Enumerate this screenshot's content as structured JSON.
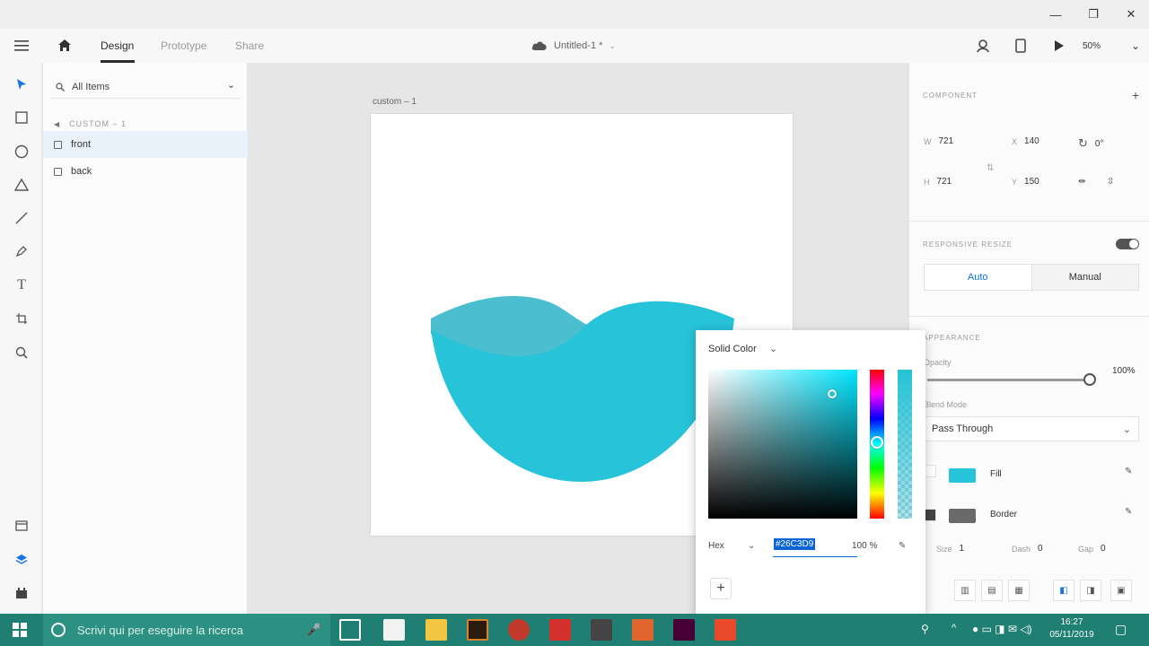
{
  "window": {
    "controls": [
      "—",
      "❐",
      "✕"
    ]
  },
  "appbar": {
    "tabs": [
      "Design",
      "Prototype",
      "Share"
    ],
    "doc_title": "Untitled-1 *",
    "zoom": "50%"
  },
  "layers": {
    "search_label": "All Items",
    "group_name": "CUSTOM – 1",
    "items": [
      "front",
      "back"
    ]
  },
  "canvas": {
    "artboard_name": "custom – 1",
    "shape_colors": {
      "front": "#26C3D9",
      "back": "#4BBFCF"
    }
  },
  "color_picker": {
    "mode": "Solid Color",
    "format": "Hex",
    "hex": "#26C3D9",
    "opacity": "100 %",
    "add": "+"
  },
  "inspector": {
    "component_title": "COMPONENT",
    "w_label": "W",
    "w": "721",
    "h_label": "H",
    "h": "721",
    "x_label": "X",
    "x": "140",
    "y_label": "Y",
    "y": "150",
    "rotation": "0°",
    "responsive_title": "RESPONSIVE RESIZE",
    "resize_auto": "Auto",
    "resize_manual": "Manual",
    "appearance_title": "APPEARANCE",
    "opacity_label": "Opacity",
    "opacity_value": "100%",
    "blend_label": "Blend Mode",
    "blend_value": "Pass Through",
    "fill_label": "Fill",
    "fill_color": "#26C3D9",
    "border_label": "Border",
    "border_color": "#6a6a6a",
    "size_label": "Size",
    "size": "1",
    "dash_label": "Dash",
    "dash": "0",
    "gap_label": "Gap",
    "gap": "0"
  },
  "taskbar": {
    "search_placeholder": "Scrivi qui per eseguire la ricerca",
    "time": "16:27",
    "date": "05/11/2019"
  }
}
